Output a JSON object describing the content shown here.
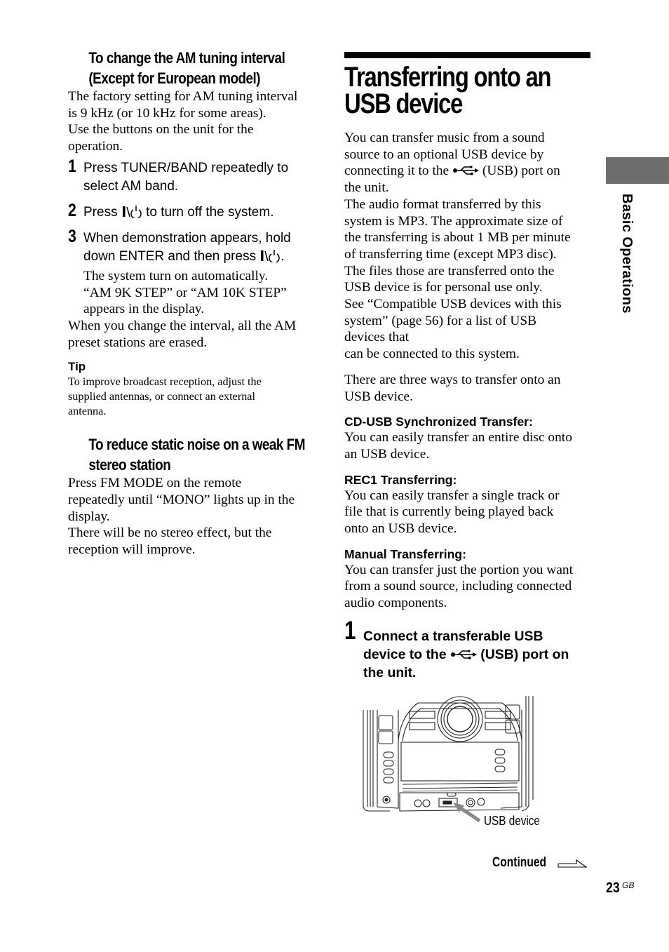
{
  "left_column": {
    "am_heading": "To change the AM tuning interval (Except for European model)",
    "am_heading_line1": "To change the AM tuning interval",
    "am_heading_line2": "(Except for European model)",
    "am_intro": "The factory setting for AM tuning interval is 9 kHz (or 10 kHz for some areas). Use the buttons on the unit for the operation.",
    "am_intro_lines": [
      "The factory setting for AM tuning interval",
      "is 9 kHz (or 10 kHz for some areas).",
      "Use the buttons on the unit for the",
      "operation."
    ],
    "steps": [
      {
        "num": "1",
        "lines": [
          "Press TUNER/BAND repeatedly to",
          "select AM band."
        ]
      },
      {
        "num": "2",
        "text_before": "Press ",
        "power_symbol": "I/⏻",
        "text_after": " to turn off the system."
      },
      {
        "num": "3",
        "lines": [
          "When demonstration appears, hold",
          "down ENTER and then press "
        ],
        "power_symbol": "I/⏻",
        "end": ".",
        "sub_lines": [
          "The system turn on automatically.",
          "“AM 9K STEP” or “AM 10K STEP”",
          "appears in the display."
        ]
      }
    ],
    "am_note_lines": [
      "When you change the interval, all the AM",
      "preset stations are erased."
    ],
    "tip_label": "Tip",
    "tip_lines": [
      "To improve broadcast reception, adjust the",
      "supplied antennas, or connect an external",
      "antenna."
    ],
    "fm_heading_line1": "To reduce static noise on a weak FM",
    "fm_heading_line2": "stereo station",
    "fm_lines": [
      "Press FM MODE on the remote",
      "repeatedly until “MONO” lights up in the",
      "display.",
      "There will be no stereo effect, but the",
      "reception will improve."
    ]
  },
  "right_column": {
    "title_line1": "Transferring onto an",
    "title_line2": "USB device",
    "intro_line1": "You can transfer music from a sound",
    "intro_line2": "source to an optional USB device by",
    "intro_line3_before": "connecting it to the ",
    "intro_line3_after": " (USB) port on",
    "intro_line4": "the unit.",
    "para_lines": [
      "The audio format transferred by this",
      "system is MP3. The approximate size of",
      "the transferring is about 1 MB per minute",
      "of transferring time (except MP3 disc).",
      "The files those are transferred onto the",
      "USB device is for personal use only.",
      "See “Compatible USB devices with this",
      "system” (page 56) for a list of USB",
      "devices that",
      "can be connected to this system."
    ],
    "ways_lines": [
      "There are three ways to transfer onto an",
      "USB device."
    ],
    "methods": [
      {
        "heading": "CD-USB Synchronized Transfer:",
        "lines": [
          "You can easily transfer an entire disc onto",
          "an USB device."
        ]
      },
      {
        "heading": "REC1 Transferring:",
        "lines": [
          "You can easily transfer a single track or",
          "file that is currently being played back",
          "onto an USB device."
        ]
      },
      {
        "heading": "Manual Transferring:",
        "lines": [
          "You can transfer just the portion you want",
          "from a sound source, including connected",
          "audio components."
        ]
      }
    ],
    "step1": {
      "num": "1",
      "line1": "Connect a transferable USB",
      "line2_before": "device to the ",
      "line2_after": " (USB) port on",
      "line3": "the unit."
    },
    "figure_caption": "USB device",
    "continued": "Continued",
    "page_number": "23",
    "page_suffix": "GB"
  },
  "side_tab": {
    "label": "Basic Operations",
    "color": "#6e6e6e"
  },
  "icons": {
    "usb": "usb-icon",
    "power": "power-icon",
    "continued_arrow": "arrow-right-icon"
  }
}
